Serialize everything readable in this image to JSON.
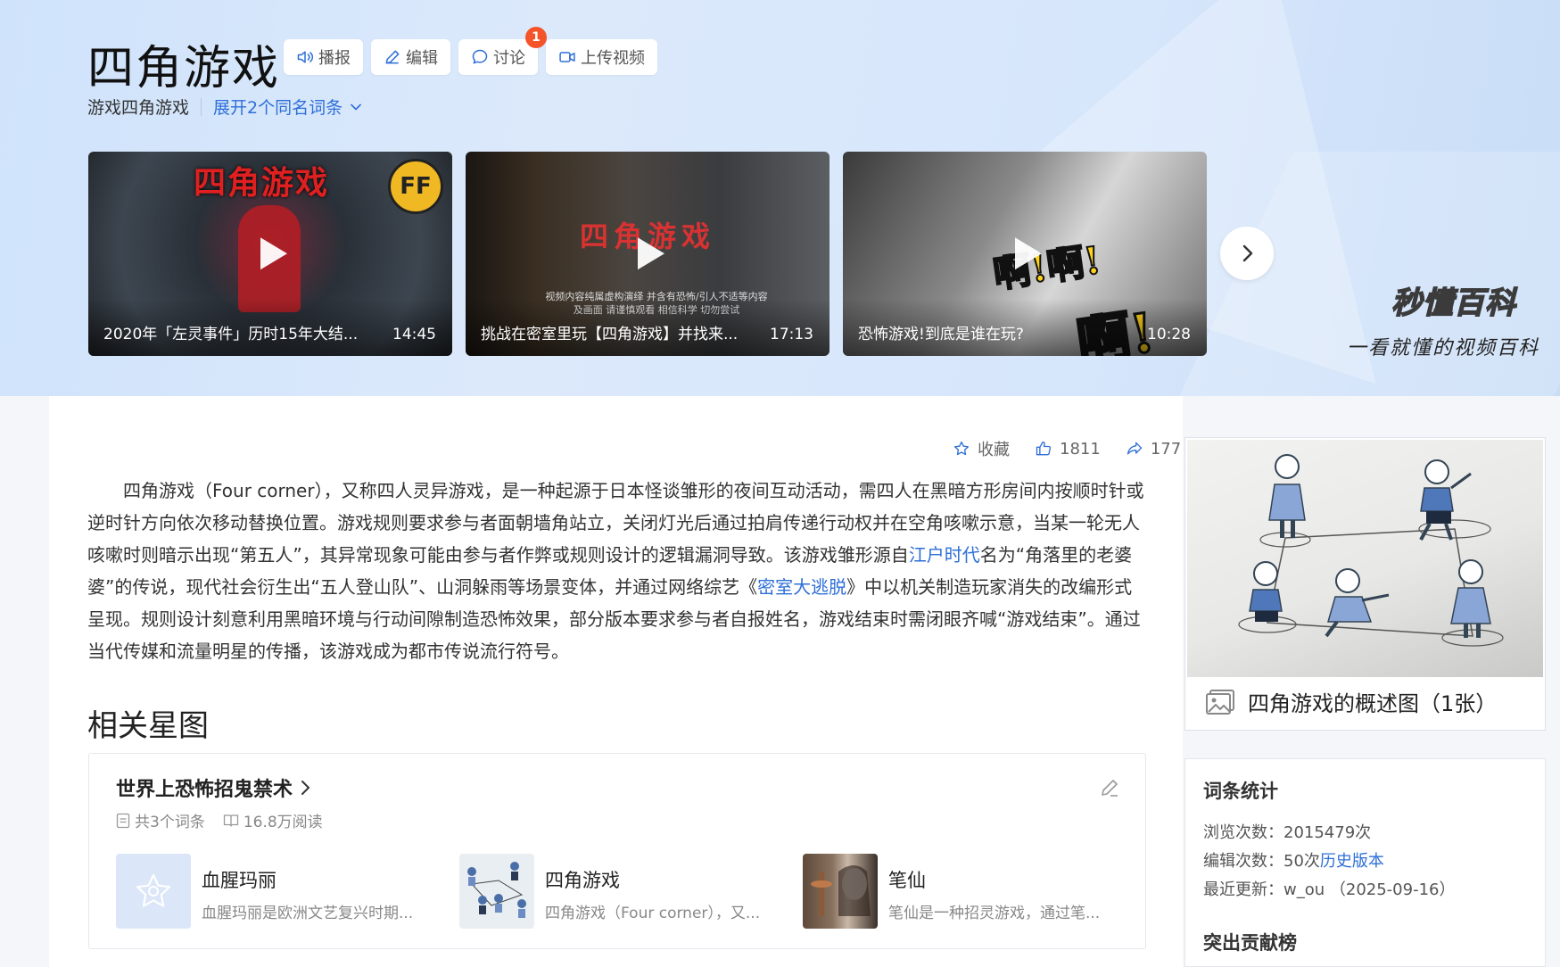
{
  "header": {
    "title": "四角游戏",
    "tools": [
      {
        "label": "播报",
        "icon": "speaker-icon"
      },
      {
        "label": "编辑",
        "icon": "pencil-icon"
      },
      {
        "label": "讨论",
        "icon": "chat-bubble-icon",
        "badge": "1"
      },
      {
        "label": "上传视频",
        "icon": "video-camera-icon"
      }
    ],
    "category": "游戏四角游戏",
    "expand_label": "展开2个同名词条"
  },
  "videos": [
    {
      "title": "2020年「左灵事件」历时15年大结...",
      "duration": "14:45",
      "poster_text": "四角游戏",
      "logo": "FF"
    },
    {
      "title": "挑战在密室里玩【四角游戏】并找来...",
      "duration": "17:13",
      "poster_text": "四角游戏",
      "poster_note": "视频内容纯属虚构演绎 并含有恐怖/引人不适等内容及画面 请谨慎观看 相信科学 切勿尝试"
    },
    {
      "title": "恐怖游戏!到底是谁在玩?",
      "duration": "10:28",
      "poster_text": "啊!啊!",
      "poster_text2": "啊!"
    }
  ],
  "brand": {
    "name": "秒懂百科",
    "slogan": "一看就懂的视频百科"
  },
  "actions": {
    "collect": "收藏",
    "likes": "1811",
    "shares": "177"
  },
  "summary": {
    "part1": "四角游戏（Four corner），又称四人灵异游戏，是一种起源于日本怪谈雏形的夜间互动活动，需四人在黑暗方形房间内按顺时针或逆时针方向依次移动替换位置。游戏规则要求参与者面朝墙角站立，关闭灯光后通过拍肩传递行动权并在空角咳嗽示意，当某一轮无人咳嗽时则暗示出现“第五人”，其异常现象可能由参与者作弊或规则设计的逻辑漏洞导致。该游戏雏形源自",
    "link1": "江户时代",
    "part2": "名为“角落里的老婆婆”的传说，现代社会衍生出“五人登山队”、山洞躲雨等场景变体，并通过网络综艺《",
    "link2": "密室大逃脱",
    "part3": "》中以机关制造玩家消失的改编形式呈现。规则设计刻意利用黑暗环境与行动间隙制造恐怖效果，部分版本要求参与者自报姓名，游戏结束时需闭眼齐喊“游戏结束”。通过当代传媒和流量明星的传播，该游戏成为都市传说流行符号。"
  },
  "related": {
    "section_title": "相关星图",
    "card_title": "世界上恐怖招鬼禁术",
    "count": "共3个词条",
    "reads": "16.8万阅读",
    "items": [
      {
        "name": "血腥玛丽",
        "desc": "血腥玛丽是欧洲文艺复兴时期...",
        "thumb": "star-placeholder"
      },
      {
        "name": "四角游戏",
        "desc": "四角游戏（Four corner），又...",
        "thumb": "children-drawing"
      },
      {
        "name": "笔仙",
        "desc": "笔仙是一种招灵游戏，通过笔...",
        "thumb": "ghost-photo"
      }
    ]
  },
  "sidebar": {
    "image_caption": "四角游戏的概述图（1张）",
    "stats_title": "词条统计",
    "views_label": "浏览次数：",
    "views_value": "2015479次",
    "edits_label": "编辑次数：",
    "edits_value": "50次",
    "history_link": "历史版本",
    "updated_label": "最近更新：",
    "updated_value": "w_ou （2025-09-16）",
    "contributors_title": "突出贡献榜"
  },
  "colors": {
    "accent": "#2e6fd8",
    "badge": "#f5532a"
  }
}
